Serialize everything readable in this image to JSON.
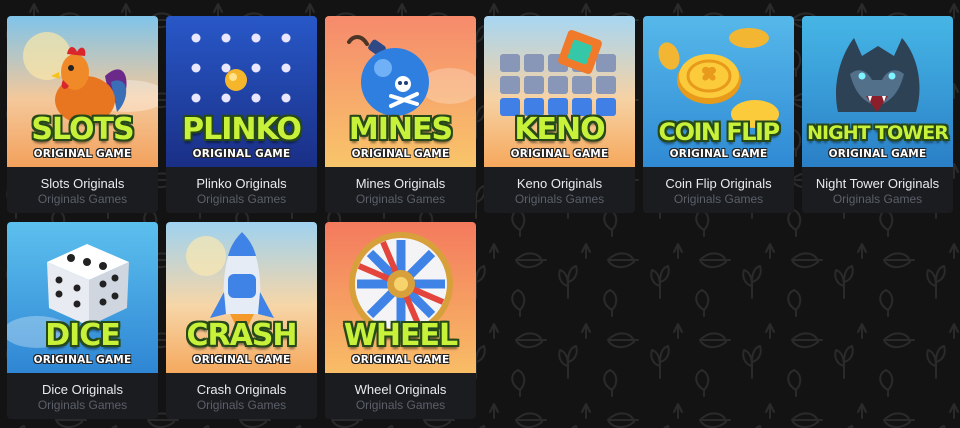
{
  "colors": {
    "page_background": "#131313",
    "card_footer": "#1a1c20",
    "title_green": "#c8f23a",
    "title_outline": "#27491a",
    "name_text": "#e9ebee",
    "category_text": "#5b6069"
  },
  "games": [
    {
      "id": "slots",
      "art_title": "SLOTS",
      "art_subtitle": "ORIGINAL GAME",
      "name": "Slots Originals",
      "category": "Originals Games",
      "icon": "rooster-icon"
    },
    {
      "id": "plinko",
      "art_title": "PLINKO",
      "art_subtitle": "ORIGINAL GAME",
      "name": "Plinko Originals",
      "category": "Originals Games",
      "icon": "plinko-pegs-icon"
    },
    {
      "id": "mines",
      "art_title": "MINES",
      "art_subtitle": "ORIGINAL GAME",
      "name": "Mines Originals",
      "category": "Originals Games",
      "icon": "bomb-icon"
    },
    {
      "id": "keno",
      "art_title": "KENO",
      "art_subtitle": "ORIGINAL GAME",
      "name": "Keno Originals",
      "category": "Originals Games",
      "icon": "keno-grid-icon"
    },
    {
      "id": "coin-flip",
      "art_title": "COIN FLIP",
      "art_subtitle": "ORIGINAL GAME",
      "name": "Coin Flip Originals",
      "category": "Originals Games",
      "icon": "gold-coin-icon"
    },
    {
      "id": "night-tower",
      "art_title": "NIGHT TOWER",
      "art_subtitle": "ORIGINAL GAME",
      "name": "Night Tower Originals",
      "category": "Originals Games",
      "icon": "werewolf-icon"
    },
    {
      "id": "dice",
      "art_title": "DICE",
      "art_subtitle": "ORIGINAL GAME",
      "name": "Dice Originals",
      "category": "Originals Games",
      "icon": "dice-icon"
    },
    {
      "id": "crash",
      "art_title": "CRASH",
      "art_subtitle": "ORIGINAL GAME",
      "name": "Crash Originals",
      "category": "Originals Games",
      "icon": "rocket-icon"
    },
    {
      "id": "wheel",
      "art_title": "WHEEL",
      "art_subtitle": "ORIGINAL GAME",
      "name": "Wheel Originals",
      "category": "Originals Games",
      "icon": "roulette-wheel-icon"
    }
  ]
}
